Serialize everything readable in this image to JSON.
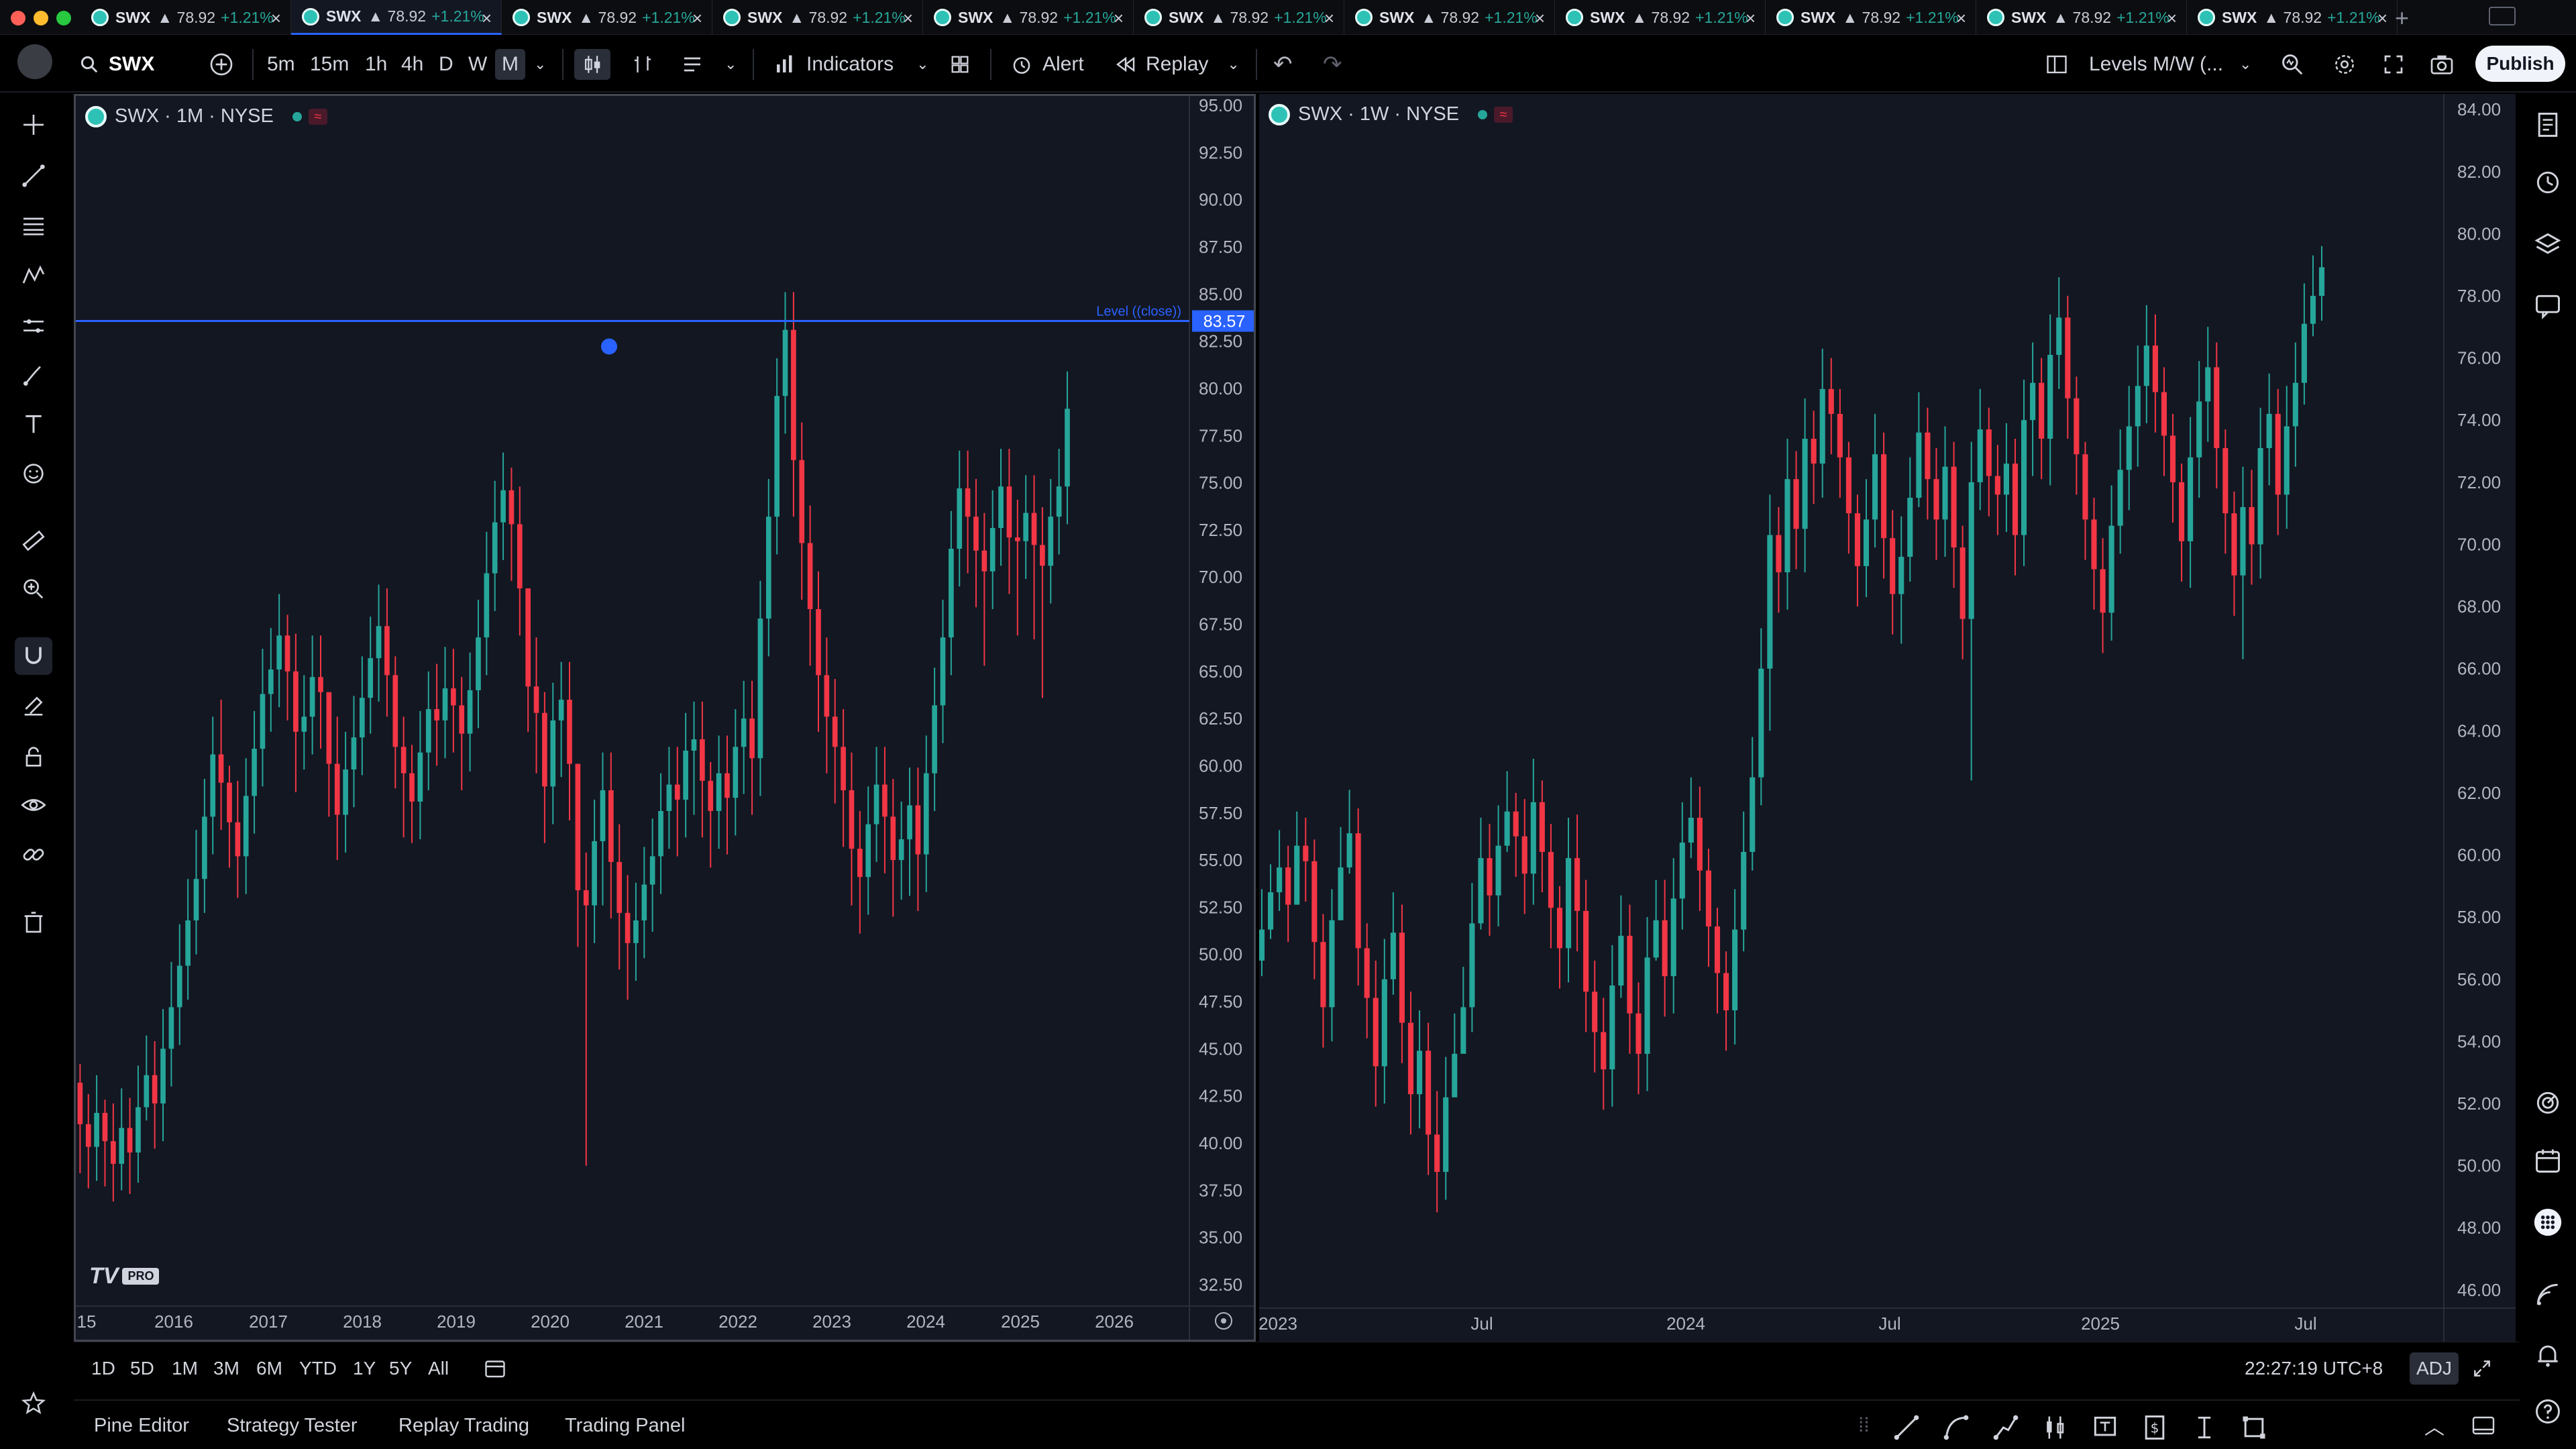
{
  "tabs": [
    {
      "symbol": "SWX",
      "price": "▲ 78.92",
      "change": "+1.21%",
      "active": false
    },
    {
      "symbol": "SWX",
      "price": "▲ 78.92",
      "change": "+1.21%",
      "active": true
    },
    {
      "symbol": "SWX",
      "price": "▲ 78.92",
      "change": "+1.21%",
      "active": false
    },
    {
      "symbol": "SWX",
      "price": "▲ 78.92",
      "change": "+1.21%",
      "active": false
    },
    {
      "symbol": "SWX",
      "price": "▲ 78.92",
      "change": "+1.21%",
      "active": false
    },
    {
      "symbol": "SWX",
      "price": "▲ 78.92",
      "change": "+1.21%",
      "active": false
    },
    {
      "symbol": "SWX",
      "price": "▲ 78.92",
      "change": "+1.21%",
      "active": false
    },
    {
      "symbol": "SWX",
      "price": "▲ 78.92",
      "change": "+1.21%",
      "active": false
    },
    {
      "symbol": "SWX",
      "price": "▲ 78.92",
      "change": "+1.21%",
      "active": false
    },
    {
      "symbol": "SWX",
      "price": "▲ 78.92",
      "change": "+1.21%",
      "active": false
    },
    {
      "symbol": "SWX",
      "price": "▲ 78.92",
      "change": "+1.21%",
      "active": false
    }
  ],
  "toolbar": {
    "symbol": "SWX",
    "intervals": [
      "5m",
      "15m",
      "1h",
      "4h",
      "D",
      "W",
      "M"
    ],
    "selected_interval": "M",
    "indicators_label": "Indicators",
    "alert_label": "Alert",
    "replay_label": "Replay",
    "layout_name": "Levels M/W (...",
    "publish_label": "Publish"
  },
  "colors": {
    "background": "#131722",
    "up": "#26a69a",
    "down": "#f23645",
    "accent": "#2962ff",
    "level_line": "#2962ff"
  },
  "left_tool_icons": [
    "crosshair-icon",
    "trend-line-icon",
    "fib-icon",
    "pattern-icon",
    "forecast-icon",
    "brush-icon",
    "text-icon",
    "emoji-icon",
    "ruler-icon",
    "zoom-in-icon",
    "magnet-icon",
    "stay-drawing-icon",
    "lock-icon",
    "eye-icon",
    "link-icon",
    "trash-icon",
    "star-icon"
  ],
  "right_tool_icons": [
    "watchlist-icon",
    "alerts-clock-icon",
    "layers-icon",
    "chat-icon",
    "ideas-icon",
    "calendar-icon",
    "apps-grid-icon",
    "stream-icon",
    "notifications-icon",
    "help-icon"
  ],
  "chart_data": [
    {
      "type": "candlestick",
      "title": "SWX · 1M · NYSE",
      "y_ticks": [
        "95.00",
        "92.50",
        "90.00",
        "87.50",
        "85.00",
        "82.50",
        "80.00",
        "77.50",
        "75.00",
        "72.50",
        "70.00",
        "67.50",
        "65.00",
        "62.50",
        "60.00",
        "57.50",
        "55.00",
        "52.50",
        "50.00",
        "47.50",
        "45.00",
        "42.50",
        "40.00",
        "37.50",
        "35.00",
        "32.50"
      ],
      "ylim": [
        31.5,
        95.5
      ],
      "x_ticks": [
        "15",
        "2016",
        "2017",
        "2018",
        "2019",
        "2020",
        "2021",
        "2022",
        "2023",
        "2024",
        "2025",
        "2026"
      ],
      "level": {
        "label": "Level ((close))",
        "value": 83.57,
        "value_label": "83.57"
      },
      "series": {
        "start": "2015-03",
        "interval": "month",
        "close": [
          43.2,
          41.0,
          39.8,
          41.6,
          40.1,
          38.9,
          40.8,
          39.5,
          41.9,
          43.6,
          42.1,
          45.0,
          47.2,
          49.4,
          51.8,
          54.0,
          57.3,
          60.6,
          59.1,
          57.0,
          55.2,
          58.4,
          60.9,
          63.8,
          65.1,
          66.9,
          65.0,
          61.8,
          62.6,
          64.7,
          63.9,
          60.1,
          57.4,
          59.8,
          61.5,
          63.6,
          65.7,
          67.4,
          64.8,
          61.0,
          59.6,
          58.1,
          60.7,
          63.0,
          62.4,
          64.1,
          63.2,
          61.7,
          64.0,
          66.8,
          70.2,
          72.9,
          74.6,
          72.8,
          69.4,
          64.2,
          62.8,
          58.9,
          62.4,
          63.5,
          60.1,
          53.4,
          52.6,
          56.0,
          58.7,
          54.9,
          52.2,
          50.6,
          51.8,
          53.7,
          55.2,
          57.6,
          59.0,
          58.2,
          60.8,
          61.4,
          59.2,
          57.6,
          59.6,
          58.3,
          61.0,
          62.5,
          60.4,
          67.8,
          73.2,
          79.6,
          83.1,
          76.2,
          71.8,
          68.3,
          64.8,
          62.6,
          61.0,
          58.7,
          55.6,
          54.1,
          56.9,
          59.0,
          57.3,
          55.0,
          56.1,
          57.9,
          55.3,
          59.6,
          63.2,
          66.8,
          71.5,
          74.7,
          73.2,
          71.4,
          70.3,
          72.6,
          74.8,
          72.1,
          71.9,
          73.4,
          71.7,
          70.6,
          73.2,
          74.8,
          78.92
        ],
        "high": [
          45.8,
          44.2,
          42.6,
          43.6,
          42.3,
          42.1,
          42.9,
          42.4,
          44.1,
          45.7,
          45.4,
          47.1,
          49.6,
          51.6,
          54.0,
          56.6,
          59.3,
          62.6,
          63.5,
          60.0,
          59.2,
          60.4,
          62.9,
          66.2,
          67.3,
          69.1,
          68.0,
          67.0,
          64.8,
          66.9,
          66.9,
          63.1,
          62.6,
          61.8,
          63.7,
          65.8,
          67.9,
          69.6,
          69.4,
          65.8,
          62.6,
          61.1,
          62.9,
          65.0,
          65.4,
          66.3,
          66.2,
          64.7,
          66.0,
          68.8,
          72.4,
          75.1,
          76.6,
          75.8,
          74.8,
          69.4,
          66.8,
          63.9,
          64.4,
          65.5,
          65.5,
          60.1,
          55.4,
          58.2,
          60.7,
          60.7,
          56.9,
          54.2,
          53.8,
          55.7,
          57.2,
          59.6,
          61.0,
          61.0,
          62.8,
          63.4,
          63.4,
          60.2,
          61.6,
          61.6,
          63.0,
          64.5,
          64.5,
          69.8,
          75.2,
          81.6,
          85.1,
          85.1,
          78.2,
          73.8,
          70.3,
          66.8,
          64.6,
          63.0,
          60.7,
          57.6,
          58.9,
          61.0,
          61.0,
          59.3,
          58.1,
          59.9,
          59.9,
          61.6,
          65.2,
          68.8,
          73.5,
          76.7,
          76.7,
          75.2,
          73.4,
          74.6,
          76.8,
          76.8,
          74.1,
          75.4,
          75.4,
          73.7,
          75.2,
          76.8,
          80.9
        ],
        "low": [
          40.4,
          38.4,
          37.6,
          38.0,
          37.7,
          36.9,
          37.5,
          37.3,
          37.9,
          41.2,
          39.7,
          40.1,
          43.0,
          45.2,
          47.6,
          50.0,
          52.2,
          55.3,
          56.6,
          54.6,
          53.0,
          53.2,
          56.4,
          58.9,
          61.8,
          63.1,
          62.4,
          58.6,
          59.8,
          60.6,
          60.9,
          57.3,
          55.0,
          55.4,
          57.8,
          59.5,
          61.7,
          63.4,
          62.6,
          58.8,
          56.2,
          55.9,
          56.1,
          58.7,
          60.0,
          60.4,
          60.7,
          58.7,
          59.7,
          62.0,
          64.8,
          68.2,
          70.9,
          69.8,
          66.9,
          61.8,
          59.6,
          55.9,
          56.9,
          59.4,
          57.1,
          50.4,
          38.8,
          50.6,
          52.6,
          51.9,
          49.2,
          47.6,
          48.6,
          49.8,
          51.2,
          53.2,
          55.6,
          55.2,
          56.2,
          57.4,
          56.2,
          54.6,
          55.6,
          55.3,
          56.3,
          58.5,
          57.4,
          58.4,
          65.8,
          71.2,
          77.6,
          73.2,
          68.8,
          65.3,
          61.8,
          59.6,
          58.0,
          55.7,
          52.6,
          51.1,
          52.1,
          54.9,
          54.3,
          52.0,
          52.9,
          53.1,
          52.3,
          53.3,
          57.6,
          61.2,
          64.8,
          69.5,
          70.2,
          68.4,
          65.3,
          68.3,
          70.6,
          69.1,
          66.9,
          69.9,
          66.7,
          63.6,
          68.6,
          71.2,
          72.8
        ]
      }
    },
    {
      "type": "candlestick",
      "title": "SWX · 1W · NYSE",
      "y_ticks": [
        "84.00",
        "82.00",
        "80.00",
        "78.00",
        "76.00",
        "74.00",
        "72.00",
        "70.00",
        "68.00",
        "66.00",
        "64.00",
        "62.00",
        "60.00",
        "58.00",
        "56.00",
        "54.00",
        "52.00",
        "50.00",
        "48.00",
        "46.00"
      ],
      "ylim": [
        45.5,
        84.5
      ],
      "x_ticks": [
        "2023",
        "Jul",
        "2024",
        "Jul",
        "2025",
        "Jul"
      ],
      "series": {
        "start": "2022-12-26",
        "interval": "week",
        "close": [
          57.6,
          58.8,
          59.6,
          58.4,
          60.3,
          59.8,
          57.2,
          55.1,
          57.9,
          59.6,
          60.7,
          57.0,
          55.4,
          53.2,
          56.0,
          57.5,
          54.6,
          52.3,
          53.7,
          51.0,
          49.8,
          52.2,
          53.6,
          55.1,
          57.8,
          59.9,
          58.7,
          60.3,
          61.4,
          60.6,
          59.4,
          61.7,
          60.1,
          58.3,
          57.0,
          59.9,
          58.2,
          55.6,
          54.3,
          53.1,
          55.8,
          57.4,
          54.9,
          53.6,
          56.7,
          57.9,
          56.1,
          58.6,
          60.4,
          61.2,
          59.5,
          57.7,
          56.2,
          55.0,
          57.6,
          60.1,
          62.5,
          66.0,
          70.3,
          69.1,
          72.1,
          70.5,
          73.4,
          72.6,
          75.0,
          74.2,
          72.8,
          71.0,
          69.3,
          70.8,
          72.9,
          70.2,
          68.4,
          69.6,
          71.5,
          73.6,
          72.1,
          70.8,
          72.5,
          69.9,
          67.6,
          72.0,
          73.7,
          72.2,
          71.6,
          72.6,
          70.3,
          74.0,
          75.2,
          73.4,
          76.1,
          77.3,
          74.7,
          72.9,
          70.8,
          69.2,
          67.8,
          70.6,
          72.4,
          73.8,
          75.1,
          76.4,
          74.9,
          73.5,
          72.0,
          70.1,
          72.8,
          74.6,
          75.7,
          73.1,
          71.0,
          69.0,
          71.2,
          70.0,
          73.1,
          74.2,
          71.6,
          73.8,
          75.2,
          77.1,
          78.0,
          78.92
        ],
        "high": [
          58.9,
          59.7,
          60.8,
          60.3,
          61.4,
          61.2,
          60.5,
          58.1,
          58.9,
          60.9,
          62.1,
          61.5,
          57.8,
          56.6,
          57.3,
          58.8,
          58.4,
          55.6,
          55.0,
          54.6,
          52.4,
          53.5,
          54.9,
          56.4,
          59.1,
          61.2,
          61.0,
          61.6,
          62.7,
          62.0,
          61.8,
          63.1,
          62.4,
          61.0,
          59.0,
          61.2,
          61.3,
          59.2,
          56.6,
          55.4,
          57.1,
          58.7,
          58.4,
          55.9,
          58.0,
          59.2,
          59.2,
          59.9,
          61.7,
          62.5,
          62.2,
          60.2,
          58.3,
          56.9,
          58.9,
          61.4,
          63.8,
          67.3,
          71.6,
          71.2,
          73.4,
          73.0,
          74.7,
          74.3,
          76.3,
          76.0,
          75.0,
          73.3,
          71.6,
          72.1,
          74.2,
          73.6,
          71.1,
          70.9,
          72.8,
          74.9,
          74.4,
          73.1,
          73.8,
          73.3,
          70.6,
          73.3,
          75.0,
          74.4,
          73.2,
          73.9,
          73.4,
          75.3,
          76.5,
          76.0,
          77.4,
          78.6,
          78.0,
          75.4,
          73.3,
          71.5,
          70.2,
          71.9,
          73.7,
          75.1,
          76.4,
          77.7,
          77.4,
          75.7,
          74.2,
          72.6,
          74.1,
          75.9,
          77.0,
          76.5,
          73.7,
          71.7,
          72.5,
          72.4,
          74.4,
          75.5,
          75.0,
          75.1,
          76.5,
          78.4,
          79.3,
          79.6
        ],
        "low": [
          56.1,
          57.3,
          58.2,
          57.2,
          58.9,
          58.5,
          56.0,
          53.8,
          54.0,
          58.3,
          59.4,
          55.8,
          54.1,
          51.9,
          52.0,
          55.5,
          53.3,
          51.0,
          51.2,
          49.7,
          48.5,
          48.9,
          52.3,
          53.8,
          54.3,
          57.6,
          57.4,
          57.7,
          60.1,
          59.3,
          58.1,
          58.4,
          58.8,
          57.0,
          55.7,
          55.9,
          56.9,
          54.3,
          53.0,
          51.8,
          51.9,
          55.4,
          53.6,
          52.3,
          52.4,
          56.6,
          54.8,
          54.9,
          57.6,
          59.9,
          58.2,
          56.4,
          54.9,
          53.7,
          53.9,
          56.9,
          59.5,
          61.6,
          64.0,
          67.8,
          67.9,
          69.2,
          69.1,
          71.3,
          71.5,
          72.9,
          71.5,
          69.7,
          68.0,
          68.3,
          69.9,
          68.9,
          67.1,
          66.8,
          68.8,
          71.2,
          70.8,
          69.5,
          69.6,
          68.6,
          66.3,
          62.4,
          71.1,
          70.9,
          70.3,
          70.4,
          69.0,
          69.3,
          72.2,
          72.1,
          71.9,
          75.0,
          73.4,
          71.6,
          69.5,
          67.9,
          66.5,
          66.9,
          69.7,
          71.1,
          72.5,
          73.9,
          73.6,
          72.2,
          70.7,
          68.8,
          68.6,
          71.5,
          73.3,
          71.8,
          69.7,
          67.7,
          66.3,
          68.7,
          68.9,
          71.9,
          70.3,
          70.5,
          72.5,
          74.5,
          76.7,
          77.2
        ]
      }
    }
  ],
  "range_bar": {
    "ranges": [
      "1D",
      "5D",
      "1M",
      "3M",
      "6M",
      "YTD",
      "1Y",
      "5Y",
      "All"
    ],
    "clock": "22:27:19 UTC+8",
    "adj_label": "ADJ"
  },
  "panel_tabs": [
    "Pine Editor",
    "Strategy Tester",
    "Replay Trading",
    "Trading Panel"
  ]
}
